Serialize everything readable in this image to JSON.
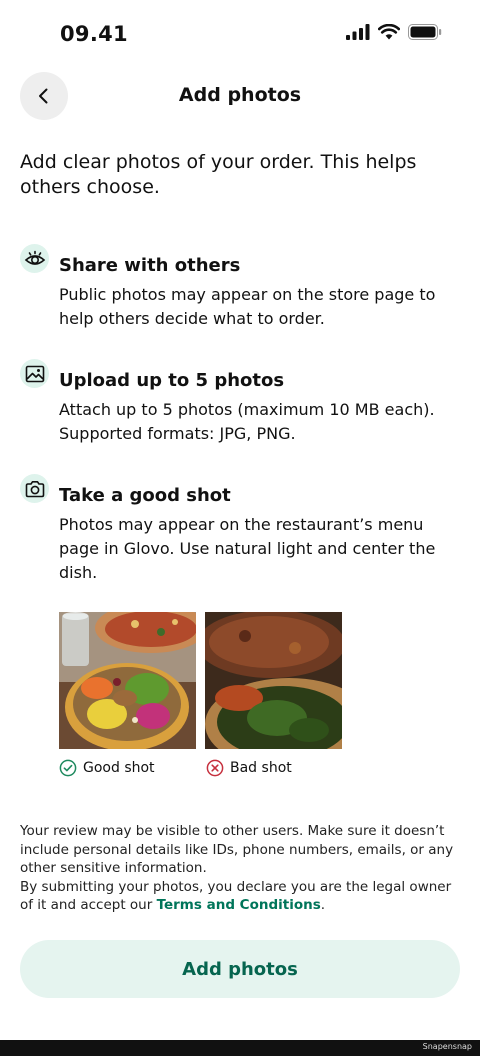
{
  "status_bar": {
    "time": "09.41"
  },
  "header": {
    "title": "Add photos"
  },
  "intro": "Add clear photos of your order. This helps others choose.",
  "sections": [
    {
      "icon": "eye-icon",
      "title": "Share with others",
      "body": "Public photos may appear on the store page to help others decide what to order."
    },
    {
      "icon": "image-icon",
      "title": "Upload up to 5 photos",
      "body": "Attach up to 5 photos (maximum 10 MB each). Supported formats: JPG, PNG."
    },
    {
      "icon": "camera-icon",
      "title": "Take a good shot",
      "body": "Photos may appear on the restaurant’s menu page in Glovo. Use natural light and center the dish."
    }
  ],
  "examples": {
    "good_label": "Good shot",
    "bad_label": "Bad shot"
  },
  "disclaimer": {
    "line1": "Your review may be visible to other users. Make sure it doesn’t include personal details like IDs, phone numbers, emails, or any other sensitive information.",
    "line2_prefix": "By submitting your photos, you declare you are the legal owner of it and accept our ",
    "terms_link": "Terms and Conditions",
    "line2_suffix": "."
  },
  "button": {
    "label": "Add photos"
  },
  "watermark": "Snapensnap",
  "colors": {
    "accent": "#00755a",
    "icon_bg": "#def3ec",
    "button_bg": "#e5f4ef",
    "good": "#1f8a5f",
    "bad": "#c6303e"
  }
}
